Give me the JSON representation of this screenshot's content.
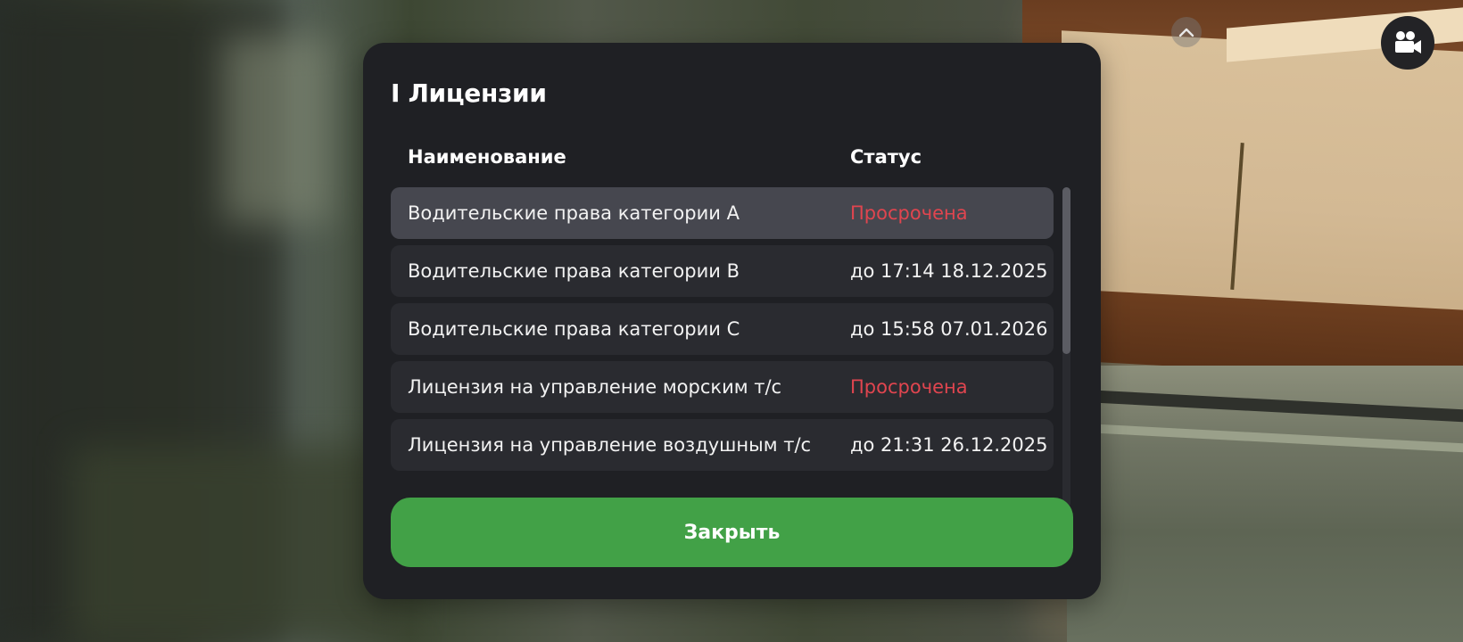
{
  "dialog": {
    "title": "I Лицензии",
    "columns": {
      "name": "Наименование",
      "status": "Статус"
    },
    "licenses": [
      {
        "name": "Водительские права категории A",
        "status": "Просрочена",
        "expired": true,
        "selected": true
      },
      {
        "name": "Водительские права категории B",
        "status": "до 17:14 18.12.2025",
        "expired": false,
        "selected": false
      },
      {
        "name": "Водительские права категории C",
        "status": "до 15:58 07.01.2026",
        "expired": false,
        "selected": false
      },
      {
        "name": "Лицензия на управление морским т/с",
        "status": "Просрочена",
        "expired": true,
        "selected": false
      },
      {
        "name": "Лицензия на управление воздушным т/с",
        "status": "до 21:31 26.12.2025",
        "expired": false,
        "selected": false
      }
    ],
    "close_label": "Закрыть"
  },
  "hud": {
    "collapse_icon": "chevron-up-icon",
    "camera_icon": "video-camera-icon"
  },
  "colors": {
    "panel": "#1f2024",
    "row": "#2a2b30",
    "row_selected": "#46474f",
    "expired": "#e0454f",
    "accent_green": "#42a147"
  }
}
